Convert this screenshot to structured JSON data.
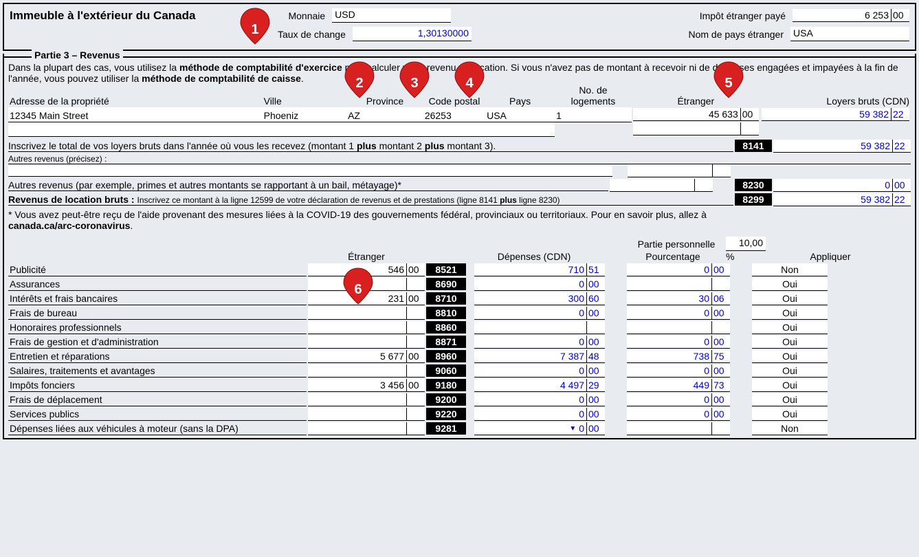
{
  "header": {
    "title": "Immeuble à l'extérieur du Canada",
    "currency_label": "Monnaie",
    "currency_value": "USD",
    "foreign_tax_label": "Impôt étranger payé",
    "foreign_tax_dollars": "6 253",
    "foreign_tax_cents": "00",
    "rate_label": "Taux de change",
    "rate_value": "1,30130000",
    "country_label": "Nom de pays étranger",
    "country_value": "USA"
  },
  "part3": {
    "title": "Partie 3 – Revenus",
    "intro_1": "Dans la plupart des cas, vous utilisez la ",
    "intro_bold_1": "méthode de comptabilité d'exercice",
    "intro_2": " pour calculer votre revenu de location. Si vous n'avez pas de montant à recevoir ni de dépenses engagées et impayées à la fin de l'année, vous pouvez utiliser la ",
    "intro_bold_2": "méthode de comptabilité de caisse",
    "intro_3": ".",
    "headers": {
      "address": "Adresse de la propriété",
      "city": "Ville",
      "province": "Province",
      "postal": "Code postal",
      "country": "Pays",
      "units": "No. de logements",
      "foreign": "Étranger",
      "gross_rent": "Loyers bruts (CDN)"
    },
    "property": {
      "address": "12345 Main Street",
      "city": "Phoeniz",
      "province": "AZ",
      "postal": "26253",
      "country": "USA",
      "units": "1",
      "foreign_dollars": "45 633",
      "foreign_cents": "00",
      "gross_dollars": "59 382",
      "gross_cents": "22"
    },
    "total_line": "Inscrivez le total de vos loyers bruts dans l'année où vous les recevez (montant 1 ",
    "plus1": "plus",
    "total_line_2": " montant 2 ",
    "plus2": "plus",
    "total_line_3": " montant 3).",
    "code_8141": "8141",
    "total_dollars": "59 382",
    "total_cents": "22",
    "other_rev_label": "Autres revenus (précisez) :",
    "other_rev_line": "Autres revenus (par exemple, primes et autres montants se rapportant à un bail, métayage)*",
    "code_8230": "8230",
    "other_dollars": "0",
    "other_cents": "00",
    "gross_rental_bold": "Revenus de location bruts : ",
    "gross_rental_note": "Inscrivez ce montant à la ligne 12599 de votre déclaration de revenus et de prestations (ligne 8141 ",
    "plus3": "plus",
    "gross_rental_note_2": " ligne 8230)",
    "code_8299": "8299",
    "gross_total_dollars": "59 382",
    "gross_total_cents": "22",
    "covid_note_1": "* Vous avez peut-être reçu de l'aide provenant des mesures liées à la COVID-19 des gouvernements fédéral, provinciaux ou territoriaux. Pour en savoir plus, allez à ",
    "covid_link": "canada.ca/arc-coronavirus",
    "covid_note_2": "."
  },
  "expenses": {
    "header_foreign": "Étranger",
    "header_cdn": "Dépenses (CDN)",
    "header_personal": "Partie personnelle",
    "header_pct": "Pourcentage",
    "pct_value": "10,00",
    "pct_sym": "%",
    "header_apply": "Appliquer",
    "rows": [
      {
        "label": "Publicité",
        "fd": "546",
        "fc": "00",
        "code": "8521",
        "cd": "710",
        "cc": "51",
        "pd": "0",
        "pc": "00",
        "appl": "Non"
      },
      {
        "label": "Assurances",
        "fd": "",
        "fc": "",
        "code": "8690",
        "cd": "0",
        "cc": "00",
        "pd": "",
        "pc": "",
        "appl": "Oui"
      },
      {
        "label": "Intérêts et frais bancaires",
        "fd": "231",
        "fc": "00",
        "code": "8710",
        "cd": "300",
        "cc": "60",
        "pd": "30",
        "pc": "06",
        "appl": "Oui"
      },
      {
        "label": "Frais de bureau",
        "fd": "",
        "fc": "",
        "code": "8810",
        "cd": "0",
        "cc": "00",
        "pd": "0",
        "pc": "00",
        "appl": "Oui"
      },
      {
        "label": "Honoraires professionnels",
        "fd": "",
        "fc": "",
        "code": "8860",
        "cd": "",
        "cc": "",
        "pd": "",
        "pc": "",
        "appl": "Oui"
      },
      {
        "label": "Frais de gestion et d'administration",
        "fd": "",
        "fc": "",
        "code": "8871",
        "cd": "0",
        "cc": "00",
        "pd": "0",
        "pc": "00",
        "appl": "Oui"
      },
      {
        "label": "Entretien et réparations",
        "fd": "5 677",
        "fc": "00",
        "code": "8960",
        "cd": "7 387",
        "cc": "48",
        "pd": "738",
        "pc": "75",
        "appl": "Oui"
      },
      {
        "label": "Salaires, traitements et avantages",
        "fd": "",
        "fc": "",
        "code": "9060",
        "cd": "0",
        "cc": "00",
        "pd": "0",
        "pc": "00",
        "appl": "Oui"
      },
      {
        "label": "Impôts fonciers",
        "fd": "3 456",
        "fc": "00",
        "code": "9180",
        "cd": "4 497",
        "cc": "29",
        "pd": "449",
        "pc": "73",
        "appl": "Oui"
      },
      {
        "label": "Frais de déplacement",
        "fd": "",
        "fc": "",
        "code": "9200",
        "cd": "0",
        "cc": "00",
        "pd": "0",
        "pc": "00",
        "appl": "Oui"
      },
      {
        "label": "Services publics",
        "fd": "",
        "fc": "",
        "code": "9220",
        "cd": "0",
        "cc": "00",
        "pd": "0",
        "pc": "00",
        "appl": "Oui"
      },
      {
        "label": "Dépenses liées aux véhicules à moteur (sans la DPA)",
        "fd": "",
        "fc": "",
        "code": "9281",
        "cd": "0",
        "cc": "00",
        "pd": "",
        "pc": "",
        "appl": "Non",
        "tri": true
      }
    ]
  },
  "callouts": {
    "c1": "1",
    "c2": "2",
    "c3": "3",
    "c4": "4",
    "c5": "5",
    "c6": "6"
  }
}
